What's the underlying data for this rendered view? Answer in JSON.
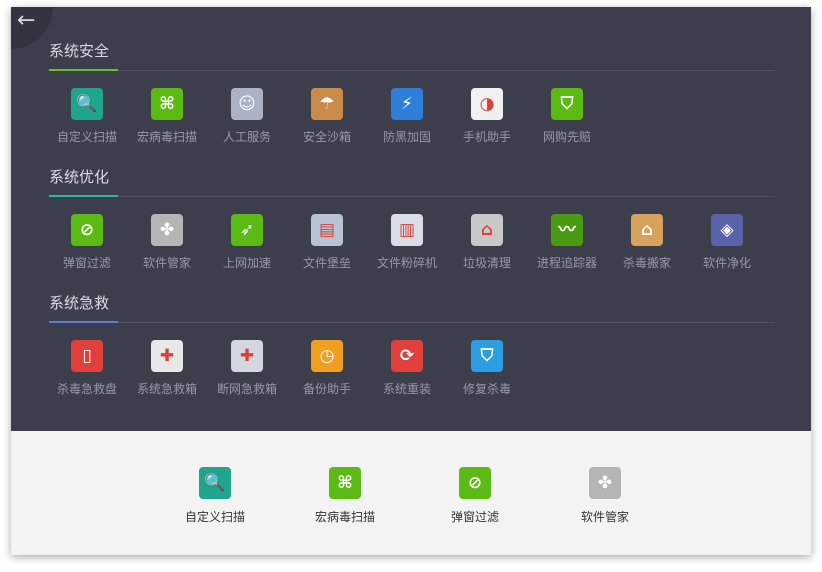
{
  "sections": [
    {
      "title": "系统安全",
      "accent": "#6cbf2a",
      "items": [
        {
          "label": "自定义扫描",
          "icon": "magnifier-icon",
          "color": "#1fa58e",
          "glyph": "🔍"
        },
        {
          "label": "宏病毒扫描",
          "icon": "macro-scan-icon",
          "color": "#5cba15",
          "glyph": "⌘"
        },
        {
          "label": "人工服务",
          "icon": "doctor-icon",
          "color": "#a9b3c4",
          "glyph": "☺"
        },
        {
          "label": "安全沙箱",
          "icon": "sandbox-icon",
          "color": "#c98a4a",
          "glyph": "☂"
        },
        {
          "label": "防黑加固",
          "icon": "lightning-icon",
          "color": "#2f7fd8",
          "glyph": "⚡"
        },
        {
          "label": "手机助手",
          "icon": "phone-assistant-icon",
          "color": "#f0f0f0",
          "glyph": "◑"
        },
        {
          "label": "网购先赔",
          "icon": "shield-cart-icon",
          "color": "#5cba15",
          "glyph": "⛉"
        }
      ]
    },
    {
      "title": "系统优化",
      "accent": "#2fb8a0",
      "items": [
        {
          "label": "弹窗过滤",
          "icon": "popup-filter-icon",
          "color": "#5cba15",
          "glyph": "⊘"
        },
        {
          "label": "软件管家",
          "icon": "software-manager-icon",
          "color": "#b5b5b5",
          "glyph": "✤"
        },
        {
          "label": "上网加速",
          "icon": "rocket-icon",
          "color": "#5cba15",
          "glyph": "➶"
        },
        {
          "label": "文件堡垒",
          "icon": "file-fortress-icon",
          "color": "#b8c3d4",
          "glyph": "▤"
        },
        {
          "label": "文件粉碎机",
          "icon": "shredder-icon",
          "color": "#d9dde6",
          "glyph": "▥"
        },
        {
          "label": "垃圾清理",
          "icon": "cleanup-icon",
          "color": "#c8c8c8",
          "glyph": "⌂"
        },
        {
          "label": "进程追踪器",
          "icon": "process-tracker-icon",
          "color": "#4a9a12",
          "glyph": "〰"
        },
        {
          "label": "杀毒搬家",
          "icon": "antivirus-move-icon",
          "color": "#d9a25c",
          "glyph": "⌂"
        },
        {
          "label": "软件净化",
          "icon": "layers-icon",
          "color": "#5a63a8",
          "glyph": "◈"
        }
      ]
    },
    {
      "title": "系统急救",
      "accent": "#5b7fd6",
      "items": [
        {
          "label": "杀毒急救盘",
          "icon": "usb-rescue-icon",
          "color": "#e0403a",
          "glyph": "▯"
        },
        {
          "label": "系统急救箱",
          "icon": "first-aid-kit-icon",
          "color": "#e8e8e8",
          "glyph": "✚"
        },
        {
          "label": "断网急救箱",
          "icon": "network-rescue-icon",
          "color": "#d3d7df",
          "glyph": "✚"
        },
        {
          "label": "备份助手",
          "icon": "backup-icon",
          "color": "#f0a020",
          "glyph": "◷"
        },
        {
          "label": "系统重装",
          "icon": "reinstall-icon",
          "color": "#e0403a",
          "glyph": "⟳"
        },
        {
          "label": "修复杀毒",
          "icon": "repair-shield-icon",
          "color": "#2a9ee0",
          "glyph": "⛉"
        }
      ]
    }
  ],
  "shortcuts": [
    {
      "label": "自定义扫描",
      "icon": "magnifier-icon",
      "color": "#1fa58e",
      "glyph": "🔍"
    },
    {
      "label": "宏病毒扫描",
      "icon": "macro-scan-icon",
      "color": "#5cba15",
      "glyph": "⌘"
    },
    {
      "label": "弹窗过滤",
      "icon": "popup-filter-icon",
      "color": "#5cba15",
      "glyph": "⊘"
    },
    {
      "label": "软件管家",
      "icon": "software-manager-icon",
      "color": "#b5b5b5",
      "glyph": "✤"
    }
  ]
}
